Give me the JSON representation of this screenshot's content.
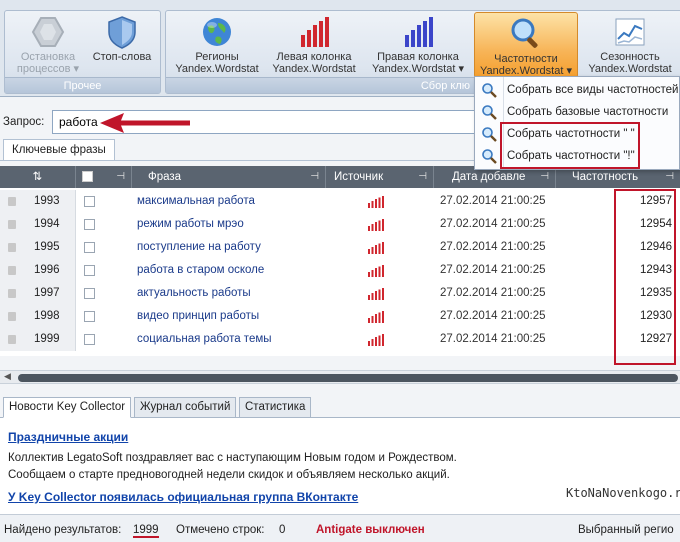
{
  "ribbon": {
    "group_misc": {
      "caption": "Прочее",
      "buttons": [
        {
          "label1": "Остановка",
          "label2": "процессов ▾",
          "icon": "stop-hexagon-icon",
          "disabled": true
        },
        {
          "label1": "Стоп-слова",
          "label2": "",
          "icon": "shield-icon",
          "disabled": false
        }
      ]
    },
    "group_collect": {
      "caption": "Сбор клю",
      "buttons": [
        {
          "label1": "Регионы",
          "label2": "Yandex.Wordstat",
          "icon": "globe-icon"
        },
        {
          "label1": "Левая колонка",
          "label2": "Yandex.Wordstat",
          "icon": "red-bars-icon"
        },
        {
          "label1": "Правая колонка",
          "label2": "Yandex.Wordstat ▾",
          "icon": "blue-bars-icon"
        },
        {
          "label1": "Частотности",
          "label2": "Yandex.Wordstat ▾",
          "icon": "magnifier-icon",
          "active": true
        },
        {
          "label1": "Сезонность",
          "label2": "Yandex.Wordstat",
          "icon": "line-chart-icon"
        }
      ]
    }
  },
  "query": {
    "label": "Запрос:",
    "value": "работа"
  },
  "tabs": {
    "keywords": "Ключевые фразы"
  },
  "table": {
    "headers": {
      "phrase": "Фраза",
      "source": "Источник",
      "date": "Дата добавле",
      "freq": "Частотность"
    },
    "rows": [
      {
        "n": "1993",
        "phrase": "максимальная работа",
        "date": "27.02.2014 21:00:25",
        "freq": "12957"
      },
      {
        "n": "1994",
        "phrase": "режим работы мрэо",
        "date": "27.02.2014 21:00:25",
        "freq": "12954"
      },
      {
        "n": "1995",
        "phrase": "поступление на работу",
        "date": "27.02.2014 21:00:25",
        "freq": "12946"
      },
      {
        "n": "1996",
        "phrase": "работа в старом осколе",
        "date": "27.02.2014 21:00:25",
        "freq": "12943"
      },
      {
        "n": "1997",
        "phrase": "актуальность работы",
        "date": "27.02.2014 21:00:25",
        "freq": "12935"
      },
      {
        "n": "1998",
        "phrase": "видео принцип работы",
        "date": "27.02.2014 21:00:25",
        "freq": "12930"
      },
      {
        "n": "1999",
        "phrase": "социальная работа темы",
        "date": "27.02.2014 21:00:25",
        "freq": "12927"
      }
    ]
  },
  "dropdown": {
    "items": [
      "Собрать все виды частотностей",
      "Собрать базовые частотности",
      "Собрать частотности \" \"",
      "Собрать частотности \"!\""
    ]
  },
  "bottom_tabs": [
    "Новости Key Collector",
    "Журнал событий",
    "Статистика"
  ],
  "news": {
    "title1": "Праздничные акции",
    "text1": "Коллектив LegatoSoft поздравляет вас с наступающим Новым годом и Рождеством.",
    "text2": "Сообщаем о старте предновогодней недели скидок и объявляем несколько акций.",
    "title2": "У Key Collector появилась официальная группа ВКонтакте"
  },
  "watermark": "KtoNaNovenkogo.ru",
  "status": {
    "found_label": "Найдено результатов:",
    "found_value": "1999",
    "marked_label": "Отмечено строк:",
    "marked_value": "0",
    "antigate": "Antigate выключен",
    "region": "Выбранный регио"
  },
  "colors": {
    "accent_red": "#c0152a",
    "link_blue": "#1144aa",
    "active_orange": "#f7b457"
  }
}
